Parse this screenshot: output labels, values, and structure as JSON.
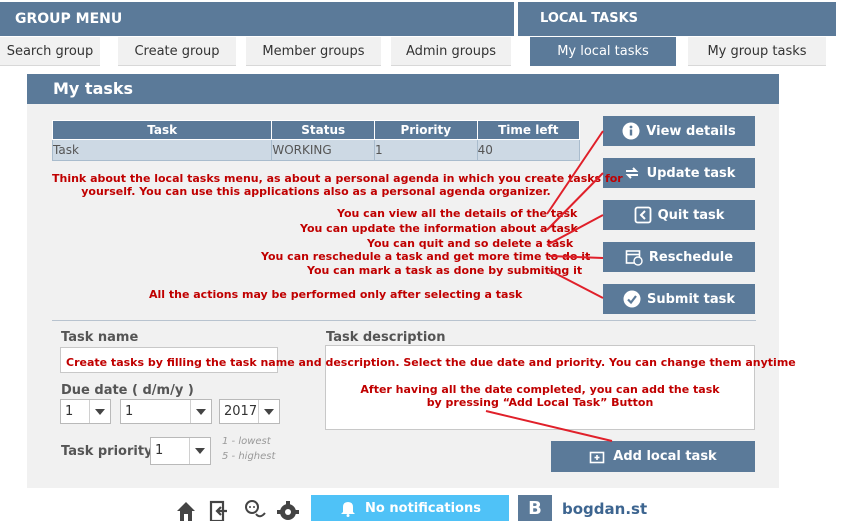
{
  "header": {
    "group_menu_title": "GROUP MENU",
    "local_tasks_title": "LOCAL TASKS"
  },
  "tabs": [
    {
      "label": "Search group"
    },
    {
      "label": "Create group"
    },
    {
      "label": "Member groups"
    },
    {
      "label": "Admin groups"
    },
    {
      "label": "My local tasks",
      "active": true
    },
    {
      "label": "My group tasks"
    }
  ],
  "panel": {
    "title": "My tasks"
  },
  "table": {
    "headers": [
      "Task",
      "Status",
      "Priority",
      "Time left"
    ],
    "rows": [
      [
        "Task",
        "WORKING",
        "1",
        "40"
      ]
    ]
  },
  "actions": {
    "view_details": "View details",
    "update_task": "Update task",
    "quit_task": "Quit task",
    "reschedule": "Reschedule",
    "submit_task": "Submit task"
  },
  "annotations": {
    "intro_line1": "Think about the local tasks menu, as about a personal agenda in which you create tasks for",
    "intro_line2": "yourself. You can use  this applications also as a personal agenda organizer.",
    "view": "You can view all the details of the task",
    "update": "You can update the information about a task",
    "quit": "You can quit and so delete a task",
    "reschedule": "You can reschedule a task and get more time to do it",
    "submit": "You can mark a task as done by submiting it",
    "selecting": "All the actions may be performed only after selecting a task",
    "create": "Create tasks by filling the task name and description. Select the due date and priority. You can change them anytime",
    "add_line1": "After having all the date completed, you can add the task",
    "add_line2": "by pressing “Add Local Task” Button"
  },
  "form": {
    "task_name_label": "Task name",
    "task_description_label": "Task description",
    "due_date_label": "Due date ( d/m/y )",
    "day": "1",
    "month": "1",
    "year": "2017",
    "priority_label": "Task priority",
    "priority": "1",
    "hint_lowest": "1 - lowest",
    "hint_highest": "5 - highest",
    "add_button": "Add local task"
  },
  "footer": {
    "notifications": "No notifications",
    "avatar_letter": "B",
    "username": "bogdan.st"
  },
  "icons": [
    "home-icon",
    "logout-icon",
    "chat-icon",
    "gear-icon",
    "bell-icon",
    "info-icon",
    "refresh-icon",
    "quit-icon",
    "calendar-icon",
    "check-circle-icon",
    "add-task-icon",
    "chevron-down-icon"
  ],
  "colors": {
    "header_blue": "#5b7a99",
    "annotation_red": "#c00000",
    "notification_blue": "#4fc2f7",
    "panel_gray": "#f1f1f1"
  }
}
